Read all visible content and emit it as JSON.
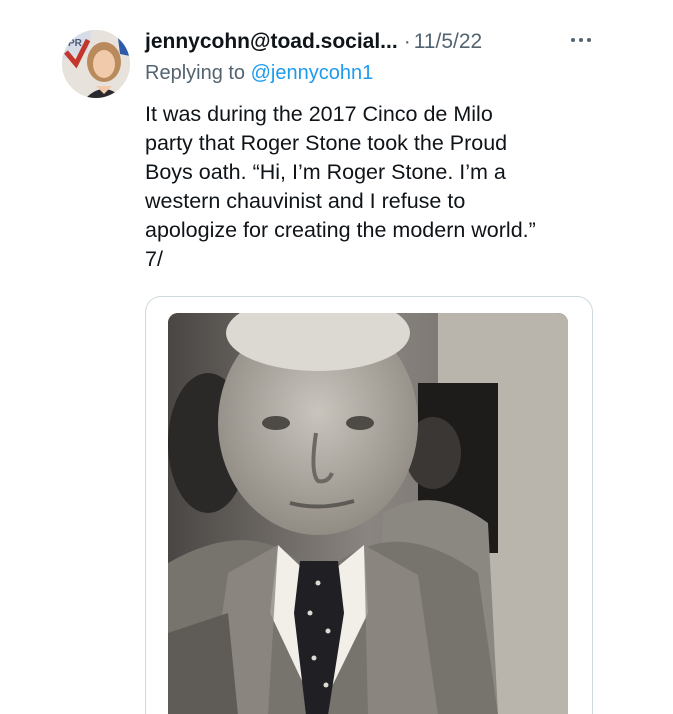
{
  "tweet": {
    "handle": "jennycohn@toad.social...",
    "separator": "·",
    "timestamp": "11/5/22",
    "reply_prefix": "Replying to ",
    "reply_mention": "@jennycohn1",
    "text": "It was during the 2017 Cinco de Milo\nparty that Roger Stone took the Proud\nBoys oath. “Hi, I’m Roger Stone. I’m a\nwestern chauvinist and I refuse to\napologize for creating the modern world.”\n7/",
    "avatar_badge_text": "PR",
    "icons": {
      "more": "more-horizontal-icon"
    },
    "colors": {
      "text": "#0f1419",
      "secondary": "#536471",
      "link": "#1d9bf0",
      "card_border": "#cfd9de"
    }
  }
}
